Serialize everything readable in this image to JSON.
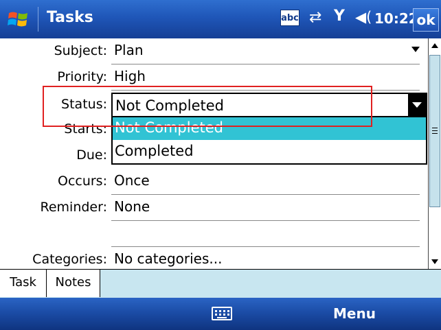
{
  "titlebar": {
    "app_title": "Tasks",
    "input_mode": "abc",
    "clock": "10:22",
    "ok_label": "ok"
  },
  "form": {
    "subject": {
      "label": "Subject:",
      "value": "Plan"
    },
    "priority": {
      "label": "Priority:",
      "value": "High"
    },
    "status": {
      "label": "Status:",
      "value": "Not Completed",
      "options": [
        "Not Completed",
        "Completed"
      ],
      "selected_index": 0
    },
    "starts": {
      "label": "Starts:"
    },
    "due": {
      "label": "Due:"
    },
    "occurs": {
      "label": "Occurs:",
      "value": "Once"
    },
    "reminder": {
      "label": "Reminder:",
      "value": "None"
    },
    "categories": {
      "label": "Categories:",
      "value": "No categories..."
    }
  },
  "tabs": [
    "Task",
    "Notes"
  ],
  "softkeys": {
    "right": "Menu"
  },
  "colors": {
    "titlebar": "#1f56b8",
    "selection": "#31c3d4",
    "highlight_box": "#e02020",
    "tabbar": "#c8e6f0"
  }
}
